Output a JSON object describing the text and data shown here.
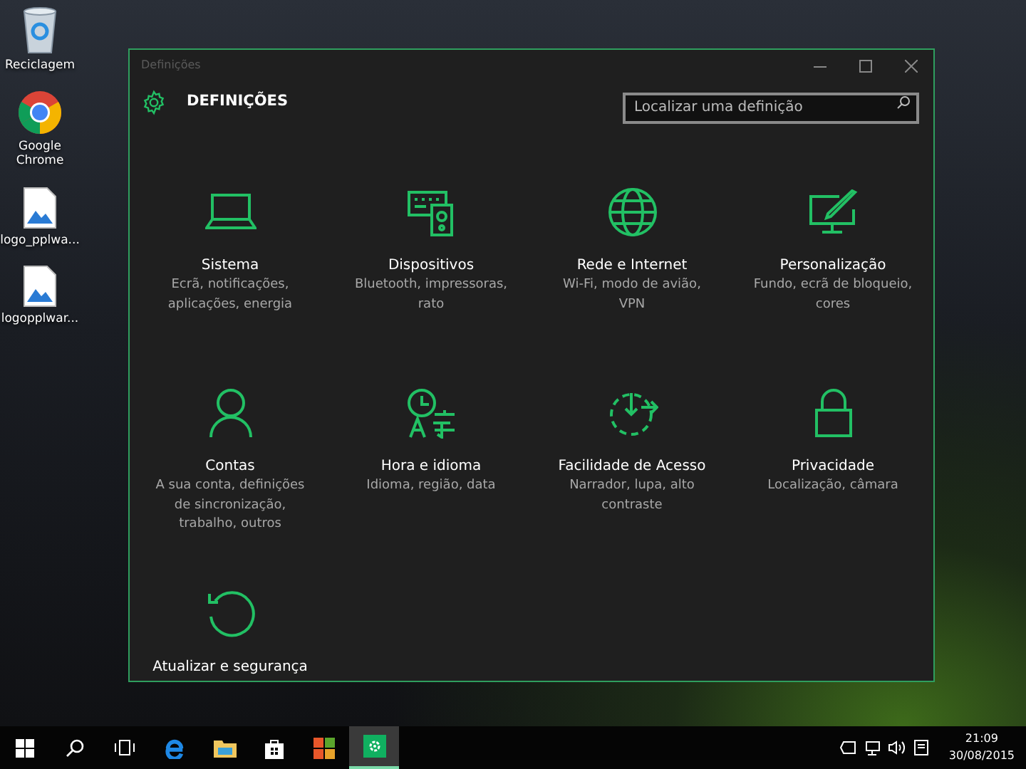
{
  "desktop_icons": [
    {
      "kind": "recycle",
      "label": "Reciclagem"
    },
    {
      "kind": "chrome",
      "label": "Google Chrome"
    },
    {
      "kind": "image",
      "label": "logo_pplwa..."
    },
    {
      "kind": "image",
      "label": "logopplwar..."
    }
  ],
  "window": {
    "title": "Definições",
    "heading": "DEFINIÇÕES",
    "search": {
      "placeholder": "Localizar uma definição"
    },
    "categories": [
      {
        "kind": "system",
        "title": "Sistema",
        "description": "Ecrã, notificações, aplicações, energia"
      },
      {
        "kind": "devices",
        "title": "Dispositivos",
        "description": "Bluetooth, impressoras, rato"
      },
      {
        "kind": "network",
        "title": "Rede e Internet",
        "description": "Wi-Fi, modo de avião, VPN"
      },
      {
        "kind": "personalization",
        "title": "Personalização",
        "description": "Fundo, ecrã de bloqueio, cores"
      },
      {
        "kind": "accounts",
        "title": "Contas",
        "description": "A sua conta, definições de sincronização, trabalho, outros"
      },
      {
        "kind": "time",
        "title": "Hora e idioma",
        "description": "Idioma, região, data"
      },
      {
        "kind": "access",
        "title": "Facilidade de Acesso",
        "description": "Narrador, lupa, alto contraste"
      },
      {
        "kind": "privacy",
        "title": "Privacidade",
        "description": "Localização, câmara"
      },
      {
        "kind": "update",
        "title": "Atualizar e segurança"
      }
    ]
  },
  "taskbar": {
    "apps": [
      {
        "kind": "start",
        "selected": false
      },
      {
        "kind": "search",
        "selected": false
      },
      {
        "kind": "taskview",
        "selected": false
      },
      {
        "kind": "edge",
        "selected": false
      },
      {
        "kind": "explorer",
        "selected": false
      },
      {
        "kind": "store",
        "selected": false
      },
      {
        "kind": "office",
        "selected": false
      },
      {
        "kind": "settings",
        "selected": true
      }
    ],
    "tray": {
      "time": "21:09",
      "date": "30/08/2015"
    }
  }
}
